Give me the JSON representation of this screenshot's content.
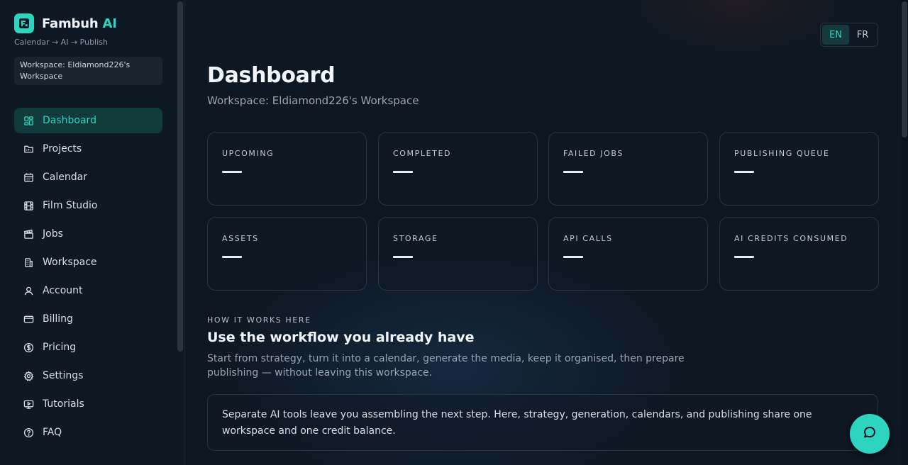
{
  "brand": {
    "name": "Fambuh",
    "name_accent": "AI",
    "tagline": "Calendar → AI → Publish"
  },
  "workspace_box": {
    "text": "Workspace: Eldiamond226's Workspace"
  },
  "nav": [
    {
      "label": "Dashboard",
      "icon": "grid-icon",
      "active": true
    },
    {
      "label": "Projects",
      "icon": "folder-icon"
    },
    {
      "label": "Calendar",
      "icon": "calendar-icon"
    },
    {
      "label": "Film Studio",
      "icon": "film-icon"
    },
    {
      "label": "Jobs",
      "icon": "clapperboard-icon"
    },
    {
      "label": "Workspace",
      "icon": "building-icon"
    },
    {
      "label": "Account",
      "icon": "user-icon"
    },
    {
      "label": "Billing",
      "icon": "credit-card-icon"
    },
    {
      "label": "Pricing",
      "icon": "dollar-circle-icon"
    },
    {
      "label": "Settings",
      "icon": "gear-icon"
    },
    {
      "label": "Tutorials",
      "icon": "monitor-play-icon"
    },
    {
      "label": "FAQ",
      "icon": "help-circle-icon"
    }
  ],
  "lang": {
    "options": [
      "EN",
      "FR"
    ],
    "active": "EN"
  },
  "header": {
    "title": "Dashboard",
    "subtitle": "Workspace: Eldiamond226's Workspace"
  },
  "stats": [
    {
      "label": "UPCOMING",
      "value": ""
    },
    {
      "label": "COMPLETED",
      "value": ""
    },
    {
      "label": "FAILED JOBS",
      "value": ""
    },
    {
      "label": "PUBLISHING QUEUE",
      "value": ""
    },
    {
      "label": "ASSETS",
      "value": ""
    },
    {
      "label": "STORAGE",
      "value": ""
    },
    {
      "label": "API CALLS",
      "value": ""
    },
    {
      "label": "AI CREDITS CONSUMED",
      "value": ""
    }
  ],
  "how_it_works": {
    "eyebrow": "HOW IT WORKS HERE",
    "title": "Use the workflow you already have",
    "body": "Start from strategy, turn it into a calendar, generate the media, keep it organised, then prepare publishing — without leaving this workspace.",
    "note": "Separate AI tools leave you assembling the next step. Here, strategy, generation, calendars, and publishing share one workspace and one credit balance."
  },
  "colors": {
    "accent": "#2dd4bf",
    "background": "#0e1822",
    "sidebar": "#0f1923"
  },
  "chat": {
    "icon": "chat-bubble-icon"
  }
}
